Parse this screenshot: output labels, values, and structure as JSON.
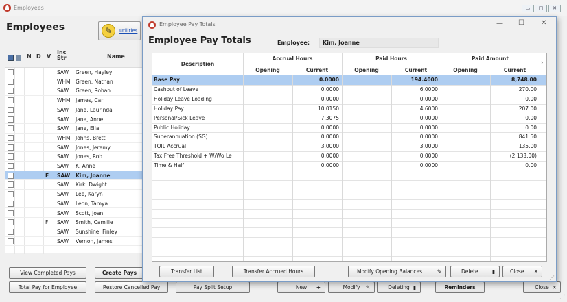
{
  "bg": {
    "title": "Employees",
    "heading": "Employees",
    "utilities_label": "Utilities",
    "columns": {
      "n": "N",
      "d": "D",
      "v": "V",
      "inc": "Inc Str",
      "name": "Name"
    },
    "employees": [
      {
        "v": "",
        "inc": "SAW",
        "name": "Green, Hayley"
      },
      {
        "v": "",
        "inc": "WHM",
        "name": "Green, Nathan"
      },
      {
        "v": "",
        "inc": "SAW",
        "name": "Green, Rohan"
      },
      {
        "v": "",
        "inc": "WHM",
        "name": "James, Carl"
      },
      {
        "v": "",
        "inc": "SAW",
        "name": "Jane, Laurinda"
      },
      {
        "v": "",
        "inc": "SAW",
        "name": "Jane, Anne"
      },
      {
        "v": "",
        "inc": "SAW",
        "name": "Jane, Ella"
      },
      {
        "v": "",
        "inc": "WHM",
        "name": "Johns, Brett"
      },
      {
        "v": "",
        "inc": "SAW",
        "name": "Jones, Jeremy"
      },
      {
        "v": "",
        "inc": "SAW",
        "name": "Jones, Rob"
      },
      {
        "v": "",
        "inc": "SAW",
        "name": "K, Anne"
      },
      {
        "v": "F",
        "inc": "SAW",
        "name": "Kim, Joanne",
        "selected": true
      },
      {
        "v": "",
        "inc": "SAW",
        "name": "Kirk, Dwight"
      },
      {
        "v": "",
        "inc": "SAW",
        "name": "Lee, Karyn"
      },
      {
        "v": "",
        "inc": "SAW",
        "name": "Leon, Tamya"
      },
      {
        "v": "",
        "inc": "SAW",
        "name": "Scott, Joan"
      },
      {
        "v": "F",
        "inc": "SAW",
        "name": "Smith, Camille"
      },
      {
        "v": "",
        "inc": "SAW",
        "name": "Sunshine, Finley"
      },
      {
        "v": "",
        "inc": "SAW",
        "name": "Vernon, James"
      }
    ],
    "buttons": {
      "view_completed": "View Completed Pays",
      "create_pays": "Create Pays",
      "total_pay": "Total Pay for Employee",
      "restore_cancelled": "Restore Cancelled Pay",
      "pay_split": "Pay Split Setup",
      "new": "New",
      "modify": "Modify",
      "deleting": "Deleting",
      "reminders": "Reminders",
      "close": "Close"
    }
  },
  "dialog": {
    "title": "Employee Pay Totals",
    "heading": "Employee Pay Totals",
    "employee_label": "Employee:",
    "employee_value": "Kim, Joanne",
    "headers": {
      "description": "Description",
      "accrual_hours": "Accrual Hours",
      "paid_hours": "Paid Hours",
      "paid_amount": "Paid Amount",
      "opening": "Opening",
      "current": "Current"
    },
    "rows": [
      {
        "desc": "Base Pay",
        "accrual_current": "0.0000",
        "paid_hours_current": "194.4000",
        "paid_amount_current": "8,748.00",
        "selected": true
      },
      {
        "desc": "Cashout of Leave",
        "accrual_current": "0.0000",
        "paid_hours_current": "6.0000",
        "paid_amount_current": "270.00"
      },
      {
        "desc": "Holiday Leave Loading",
        "accrual_current": "0.0000",
        "paid_hours_current": "0.0000",
        "paid_amount_current": "0.00"
      },
      {
        "desc": "Holiday Pay",
        "accrual_current": "10.0150",
        "paid_hours_current": "4.6000",
        "paid_amount_current": "207.00"
      },
      {
        "desc": "Personal/Sick Leave",
        "accrual_current": "7.3075",
        "paid_hours_current": "0.0000",
        "paid_amount_current": "0.00"
      },
      {
        "desc": "Public Holiday",
        "accrual_current": "0.0000",
        "paid_hours_current": "0.0000",
        "paid_amount_current": "0.00"
      },
      {
        "desc": "Superannuation (SG)",
        "accrual_current": "0.0000",
        "paid_hours_current": "0.0000",
        "paid_amount_current": "841.50"
      },
      {
        "desc": "TOIL Accrual",
        "accrual_current": "3.0000",
        "paid_hours_current": "3.0000",
        "paid_amount_current": "135.00"
      },
      {
        "desc": "Tax Free Threshold  + W/Wo Le",
        "accrual_current": "0.0000",
        "paid_hours_current": "0.0000",
        "paid_amount_current": "(2,133.00)"
      },
      {
        "desc": "Time & Half",
        "accrual_current": "0.0000",
        "paid_hours_current": "0.0000",
        "paid_amount_current": "0.00"
      }
    ],
    "buttons": {
      "transfer_list": "Transfer List",
      "transfer_accrued": "Transfer Accrued Hours",
      "modify_opening": "Modify Opening Balances",
      "delete": "Delete",
      "close": "Close"
    }
  },
  "colors": {
    "selection": "#aecdf1",
    "accent_border": "#7a9cc6",
    "brand_red": "#c0392b"
  }
}
